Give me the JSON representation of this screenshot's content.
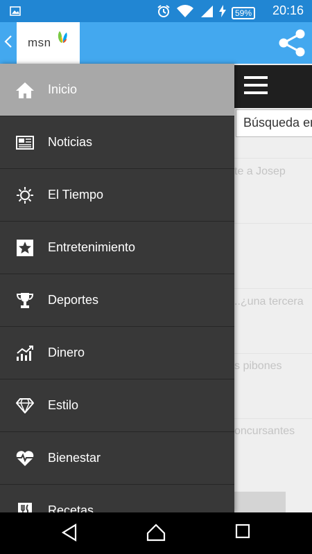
{
  "status_bar": {
    "time": "20:16",
    "battery": "59%",
    "icons": [
      "image-icon",
      "alarm-icon",
      "wifi-icon",
      "signal-icon",
      "charging-icon"
    ]
  },
  "app_bar": {
    "logo_text": "msn",
    "accent_color": "#43a8ef"
  },
  "drawer": {
    "items": [
      {
        "label": "Inicio",
        "icon": "home-icon",
        "active": true
      },
      {
        "label": "Noticias",
        "icon": "newspaper-icon"
      },
      {
        "label": "El Tiempo",
        "icon": "sun-icon"
      },
      {
        "label": "Entretenimiento",
        "icon": "star-icon"
      },
      {
        "label": "Deportes",
        "icon": "trophy-icon"
      },
      {
        "label": "Dinero",
        "icon": "chart-icon"
      },
      {
        "label": "Estilo",
        "icon": "diamond-icon"
      },
      {
        "label": "Bienestar",
        "icon": "heart-pulse-icon"
      },
      {
        "label": "Recetas",
        "icon": "utensils-icon"
      }
    ]
  },
  "content": {
    "search_placeholder": "Búsqueda en",
    "article_fragments": [
      "te a Josep",
      "..¿una tercera",
      "s pibones",
      "oncursantes"
    ]
  }
}
